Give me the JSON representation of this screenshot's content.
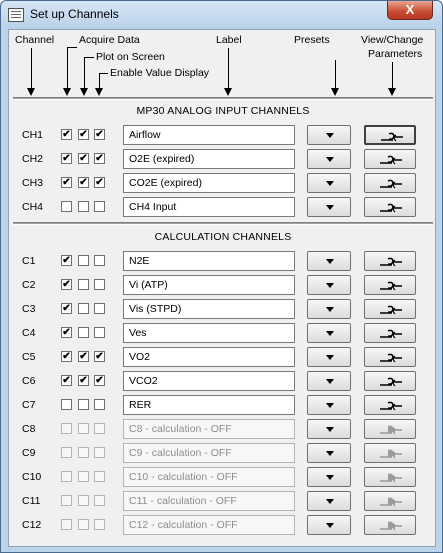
{
  "window": {
    "title": "Set up Channels",
    "close_label": "X"
  },
  "headers": {
    "channel": "Channel",
    "acquire": "Acquire Data",
    "plot": "Plot on Screen",
    "enable": "Enable Value Display",
    "label": "Label",
    "presets": "Presets",
    "view_change_1": "View/Change",
    "view_change_2": "Parameters"
  },
  "sections": {
    "analog": "MP30 ANALOG  INPUT  CHANNELS",
    "calc": "CALCULATION  CHANNELS"
  },
  "analog_channels": [
    {
      "id": "CH1",
      "acquire": true,
      "plot": true,
      "enable": true,
      "label": "Airflow",
      "enabled": true
    },
    {
      "id": "CH2",
      "acquire": true,
      "plot": true,
      "enable": true,
      "label": "O2E (expired)",
      "enabled": true
    },
    {
      "id": "CH3",
      "acquire": true,
      "plot": true,
      "enable": true,
      "label": "CO2E (expired)",
      "enabled": true
    },
    {
      "id": "CH4",
      "acquire": false,
      "plot": false,
      "enable": false,
      "label": "CH4 Input",
      "enabled": true
    }
  ],
  "calc_channels": [
    {
      "id": "C1",
      "acquire": true,
      "plot": false,
      "enable": false,
      "label": "N2E",
      "enabled": true
    },
    {
      "id": "C2",
      "acquire": true,
      "plot": false,
      "enable": false,
      "label": "Vi (ATP)",
      "enabled": true
    },
    {
      "id": "C3",
      "acquire": true,
      "plot": false,
      "enable": false,
      "label": "Vis (STPD)",
      "enabled": true
    },
    {
      "id": "C4",
      "acquire": true,
      "plot": false,
      "enable": false,
      "label": "Ves",
      "enabled": true
    },
    {
      "id": "C5",
      "acquire": true,
      "plot": true,
      "enable": true,
      "label": "VO2",
      "enabled": true
    },
    {
      "id": "C6",
      "acquire": true,
      "plot": true,
      "enable": true,
      "label": "VCO2",
      "enabled": true
    },
    {
      "id": "C7",
      "acquire": false,
      "plot": false,
      "enable": false,
      "label": "RER",
      "enabled": true
    },
    {
      "id": "C8",
      "acquire": false,
      "plot": false,
      "enable": false,
      "label": "C8 - calculation - OFF",
      "enabled": false
    },
    {
      "id": "C9",
      "acquire": false,
      "plot": false,
      "enable": false,
      "label": "C9 - calculation - OFF",
      "enabled": false
    },
    {
      "id": "C10",
      "acquire": false,
      "plot": false,
      "enable": false,
      "label": "C10 - calculation - OFF",
      "enabled": false
    },
    {
      "id": "C11",
      "acquire": false,
      "plot": false,
      "enable": false,
      "label": "C11 - calculation - OFF",
      "enabled": false
    },
    {
      "id": "C12",
      "acquire": false,
      "plot": false,
      "enable": false,
      "label": "C12 - calculation - OFF",
      "enabled": false
    }
  ],
  "icons": {
    "presets_button": "dropdown-triangle-icon",
    "parameters_button": "wrench-icon"
  },
  "colors": {
    "window_frame": "#bcd3ea",
    "client_bg": "#f0f0f0",
    "close_button": "#c84a31",
    "disabled_text": "#8d8d8d"
  }
}
